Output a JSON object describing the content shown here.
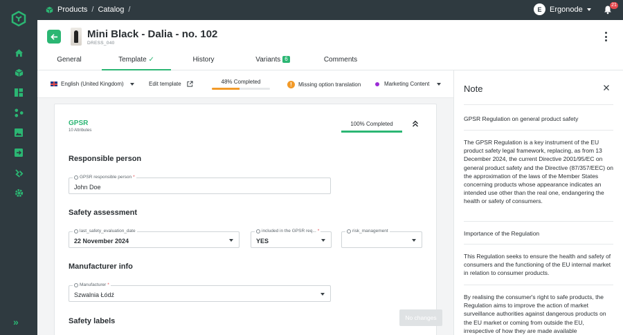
{
  "breadcrumb": {
    "items": [
      "Products",
      "Catalog"
    ],
    "separator": "/"
  },
  "user": {
    "initial": "E",
    "name": "Ergonode"
  },
  "notifications": {
    "count": "21"
  },
  "product": {
    "title": "Mini Black - Dalia - no. 102",
    "sku": "DRESS_040"
  },
  "tabs": [
    {
      "label": "General"
    },
    {
      "label": "Template",
      "check": "✓"
    },
    {
      "label": "History"
    },
    {
      "label": "Variants",
      "count": "6"
    },
    {
      "label": "Comments"
    }
  ],
  "toolbar": {
    "language": "English (United Kingdom)",
    "edit_template": "Edit template",
    "completion_label": "48% Completed",
    "completion_percent": 48,
    "missing_translation": "Missing option translation",
    "channel": "Marketing Content"
  },
  "section": {
    "title": "GPSR",
    "subtitle": "10 Attributes",
    "completion_label": "100% Completed",
    "groups": {
      "responsible": "Responsible person",
      "safety": "Safety assessment",
      "manufacturer": "Manufacturer info",
      "labels": "Safety labels"
    },
    "fields": {
      "responsible_person": {
        "label": "GPSR responsible person",
        "required": "*",
        "value": "John Doe"
      },
      "last_eval": {
        "label": "last_safety_evaluation_date",
        "value": "22 November 2024"
      },
      "included": {
        "label": "included in the GPSR req...",
        "required": "*",
        "value": "YES"
      },
      "risk": {
        "label": "risk_management",
        "value": ""
      },
      "manufacturer": {
        "label": "Manufacturer",
        "required": "*",
        "value": "Szwalnia Łódź"
      }
    }
  },
  "no_changes_label": "No changes",
  "note": {
    "title": "Note",
    "blocks": [
      "GPSR Regulation on general product safety",
      "The GPSR Regulation is a key instrument of the EU product safety legal framework, replacing, as from 13 December 2024, the current Directive 2001/95/EC on general product safety and the Directive (87/357/EEC) on the approximation of the laws of the Member States concerning products whose appearance indicates an intended use other than the real one, endangering the health or safety of consumers.",
      "Importance of the Regulation",
      "This Regulation seeks to ensure the health and safety of consumers and the functioning of the EU internal market in relation to consumer products.",
      "By realising the consumer's right to safe products, the Regulation aims to improve the action of market surveillance authorities against dangerous products on the EU market or coming from outside the EU, irrespective of how they are made available"
    ]
  },
  "colors": {
    "accent": "#2bb673",
    "sidebar": "#2f3a40",
    "warning": "#f29a29",
    "channel_dot": "#9b2bd6"
  }
}
